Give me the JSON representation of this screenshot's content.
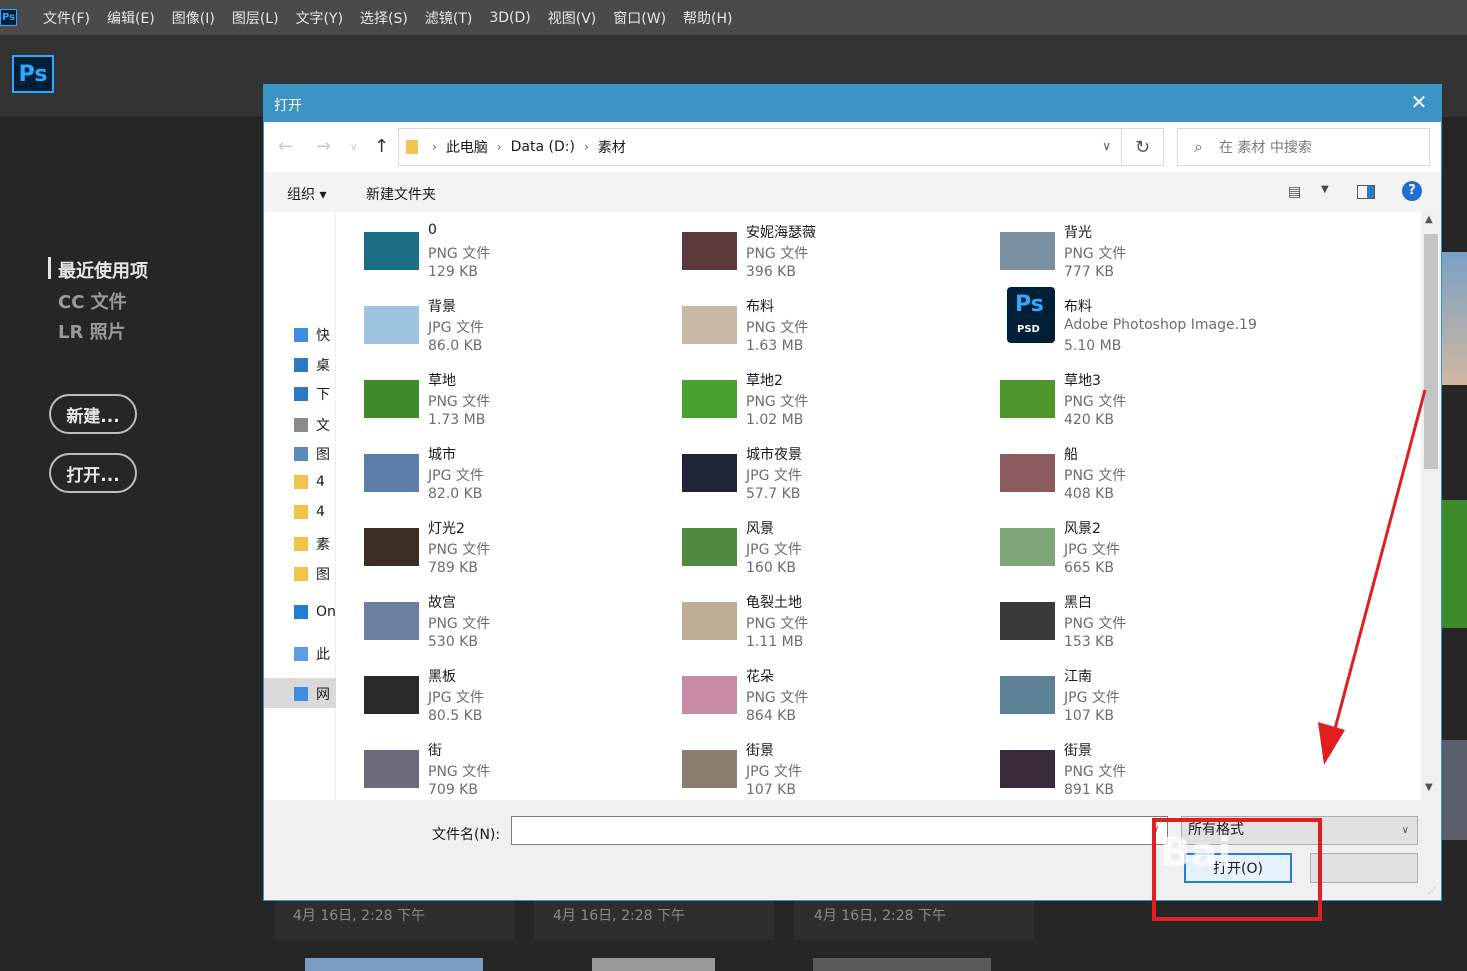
{
  "app": {
    "logo": "Ps",
    "menu": [
      "文件(F)",
      "编辑(E)",
      "图像(I)",
      "图层(L)",
      "文字(Y)",
      "选择(S)",
      "滤镜(T)",
      "3D(D)",
      "视图(V)",
      "窗口(W)",
      "帮助(H)"
    ]
  },
  "home": {
    "left_links": [
      "最近使用项",
      "CC 文件",
      "LR 照片"
    ],
    "new_button": "新建...",
    "open_button": "打开...",
    "recent_dates": [
      "4月 16日, 2:28 下午",
      "4月 16日, 2:28 下午",
      "4月 16日, 2:28 下午"
    ]
  },
  "dialog": {
    "title": "打开",
    "close": "✕",
    "breadcrumbs": [
      "此电脑",
      "Data (D:)",
      "素材"
    ],
    "search_placeholder": "在 素材 中搜索",
    "toolbar": {
      "organize": "组织 ▾",
      "new_folder": "新建文件夹",
      "help": "?"
    },
    "nav_tree": [
      "快",
      "桌",
      "下",
      "文",
      "图",
      "4",
      "4",
      "素",
      "图",
      "On",
      "此",
      "网"
    ],
    "files": [
      {
        "name": "0",
        "type": "PNG 文件",
        "size": "129 KB",
        "color": "#1a6f86"
      },
      {
        "name": "安妮海瑟薇",
        "type": "PNG 文件",
        "size": "396 KB",
        "color": "#5a3a3a"
      },
      {
        "name": "背光",
        "type": "PNG 文件",
        "size": "777 KB",
        "color": "#7a8fa0"
      },
      {
        "name": "背景",
        "type": "JPG 文件",
        "size": "86.0 KB",
        "color": "#9cc4e0"
      },
      {
        "name": "布料",
        "type": "PNG 文件",
        "size": "1.63 MB",
        "color": "#c8b8a6"
      },
      {
        "name": "布料",
        "type": "Adobe Photoshop Image.19",
        "size": "5.10 MB",
        "color": "psd"
      },
      {
        "name": "草地",
        "type": "PNG 文件",
        "size": "1.73 MB",
        "color": "#3e8a2a"
      },
      {
        "name": "草地2",
        "type": "PNG 文件",
        "size": "1.02 MB",
        "color": "#4aa02e"
      },
      {
        "name": "草地3",
        "type": "PNG 文件",
        "size": "420 KB",
        "color": "#4c962c"
      },
      {
        "name": "城市",
        "type": "JPG 文件",
        "size": "82.0 KB",
        "color": "#5a7ea8"
      },
      {
        "name": "城市夜景",
        "type": "JPG 文件",
        "size": "57.7 KB",
        "color": "#1e2436"
      },
      {
        "name": "船",
        "type": "PNG 文件",
        "size": "408 KB",
        "color": "#8a5a5e"
      },
      {
        "name": "灯光2",
        "type": "PNG 文件",
        "size": "789 KB",
        "color": "#3a2e22"
      },
      {
        "name": "风景",
        "type": "JPG 文件",
        "size": "160 KB",
        "color": "#4f8a3e"
      },
      {
        "name": "风景2",
        "type": "JPG 文件",
        "size": "665 KB",
        "color": "#7fa678"
      },
      {
        "name": "故宫",
        "type": "PNG 文件",
        "size": "530 KB",
        "color": "#6a7fa2"
      },
      {
        "name": "龟裂土地",
        "type": "PNG 文件",
        "size": "1.11 MB",
        "color": "#bfae94"
      },
      {
        "name": "黑白",
        "type": "PNG 文件",
        "size": "153 KB",
        "color": "#3a3a3a"
      },
      {
        "name": "黑板",
        "type": "JPG 文件",
        "size": "80.5 KB",
        "color": "#2a2a26"
      },
      {
        "name": "花朵",
        "type": "PNG 文件",
        "size": "864 KB",
        "color": "#c88aa4"
      },
      {
        "name": "江南",
        "type": "JPG 文件",
        "size": "107 KB",
        "color": "#5a8294"
      },
      {
        "name": "街",
        "type": "PNG 文件",
        "size": "709 KB",
        "color": "#6a6a7a"
      },
      {
        "name": "街景",
        "type": "JPG 文件",
        "size": "107 KB",
        "color": "#8a7e70"
      },
      {
        "name": "街景",
        "type": "PNG 文件",
        "size": "891 KB",
        "color": "#3a2a3a"
      }
    ],
    "footer": {
      "filename_label": "文件名(N):",
      "filename_value": "",
      "filter": "所有格式",
      "open_button": "打开(O)",
      "cancel_button": ""
    }
  },
  "annotation": {
    "watermark": "Bai"
  },
  "colors": {
    "ps_blue": "#31a8ff",
    "title_bar": "#3c94c4",
    "annotation_red": "#e02020"
  }
}
